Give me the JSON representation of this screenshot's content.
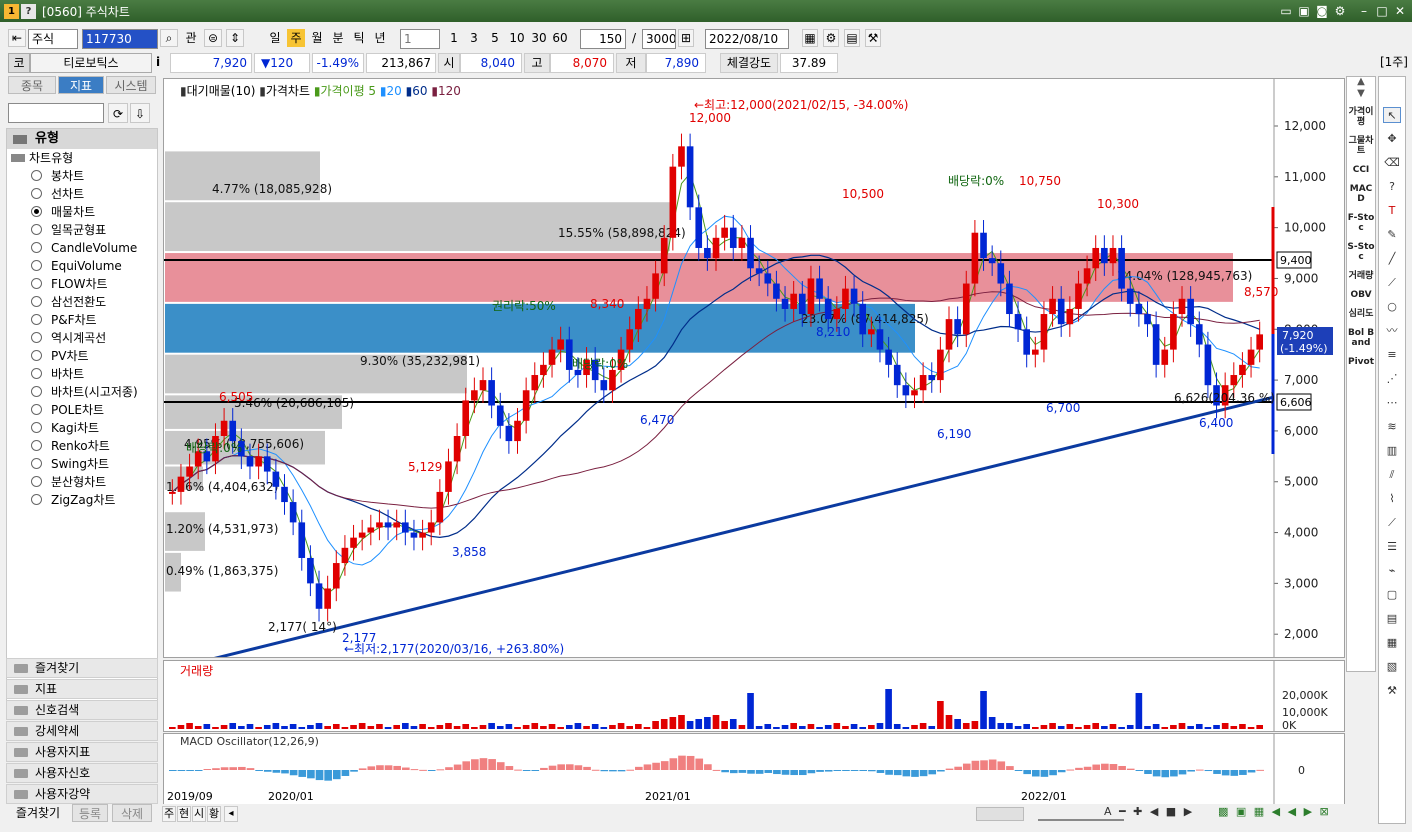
{
  "window": {
    "title": "[0560] 주식차트",
    "icon_a": "1",
    "icon_b": "?"
  },
  "toolbar": {
    "market": "주식",
    "code": "117730",
    "btn_gwan": "관",
    "periods": [
      "일",
      "주",
      "월",
      "분",
      "틱",
      "년"
    ],
    "active_period": "주",
    "sub_select": "1",
    "intervals": [
      "1",
      "3",
      "5",
      "10",
      "30",
      "60"
    ],
    "count": "150",
    "slash": "/",
    "total": "3000",
    "date": "2022/08/10"
  },
  "quote": {
    "ko": "코",
    "name": "티로보틱스",
    "info": "i",
    "price": "7,920",
    "change": "▼120",
    "rate": "-1.49%",
    "volume": "213,867",
    "open_label": "시",
    "open": "8,040",
    "high_label": "고",
    "high": "8,070",
    "low_label": "저",
    "low": "7,890",
    "strength_label": "체결강도",
    "strength": "37.89",
    "unit": "[1주]"
  },
  "left": {
    "tabs": [
      "종목",
      "지표",
      "시스템"
    ],
    "active_tab": "지표",
    "section": "유형",
    "group": "차트유형",
    "items": [
      "봉차트",
      "선차트",
      "매물차트",
      "일목균형표",
      "CandleVolume",
      "EquiVolume",
      "FLOW차트",
      "삼선전환도",
      "P&F차트",
      "역시계곡선",
      "PV차트",
      "바차트",
      "바차트(시고저종)",
      "POLE차트",
      "Kagi차트",
      "Renko차트",
      "Swing차트",
      "분산형차트",
      "ZigZag차트"
    ],
    "selected": "매물차트",
    "categories": [
      "즐겨찾기",
      "지표",
      "신호검색",
      "강세약세",
      "사용자지표",
      "사용자신호",
      "사용자강약"
    ],
    "bottom_tabs": [
      "즐겨찾기",
      "등록",
      "삭제"
    ]
  },
  "chart": {
    "legend": {
      "a": "대기매물(10)",
      "b": "가격차트",
      "c": "가격이평 5",
      "d": "20",
      "e": "60",
      "f": "120"
    },
    "price_labels": [
      "12,000",
      "11,000",
      "10,000",
      "9,000",
      "8,000",
      "7,000",
      "6,000",
      "5,000",
      "4,000",
      "3,000",
      "2,000"
    ],
    "right_tag_9400": "9,400",
    "right_tag_price": "7,920",
    "right_tag_rate": "(-1.49%)",
    "right_tag_6606": "6,606",
    "volume_profile": [
      {
        "label": "4.77% (18,085,928)"
      },
      {
        "label": "15.55% (58,898,824)"
      },
      {
        "label": "23.07% (87,414,825)"
      },
      {
        "label": "34.04% (128,945,763)"
      },
      {
        "label": "9.30% (35,232,981)"
      },
      {
        "label": "5.46% (20,686,105)"
      },
      {
        "label": "4.95% (18,755,606)"
      },
      {
        "label": "1.16% (4,404,632)"
      },
      {
        "label": "1.20% (4,531,973)"
      },
      {
        "label": "0.49% (1,863,375)"
      }
    ],
    "annotations": {
      "max": "←최고:12,000(2021/02/15, -34.00%)",
      "min": "←최저:2,177(2020/03/16, +263.80%)",
      "div1": "배당락:0%",
      "div2": "배당락:0%",
      "div3": "배당락:0%",
      "rights": "권리락:50%",
      "p12000": "12,000",
      "p10500": "10,500",
      "p10750": "10,750",
      "p10300": "10,300",
      "p8340": "8,340",
      "p8570": "8,570",
      "p8210": "8,210",
      "p6505": "6,505",
      "p5129": "5,129",
      "p3858": "3,858",
      "p2177": "2,177",
      "p6470": "6,470",
      "p6190": "6,190",
      "p6700": "6,700",
      "p6400": "6,400",
      "angle": "2,177( 14°)",
      "trend": "6,626(204.36 %)"
    },
    "volume_title": "거래량",
    "volume_labels": [
      "20,000K",
      "10,000K",
      "0K"
    ],
    "macd_title": "MACD Oscillator(12,26,9)",
    "macd_zero": "0",
    "x_labels": [
      "2019/09",
      "2020/01",
      "2021/01",
      "2022/01"
    ]
  },
  "right_tools": [
    "가격이평",
    "그물차트",
    "CCI",
    "MACD",
    "F-Stoc",
    "S-Stoc",
    "거래량",
    "OBV",
    "심리도",
    "Bol Band",
    "Pivot"
  ],
  "bottom": {
    "tabs": [
      "주",
      "현",
      "시",
      "황"
    ]
  },
  "colors": {
    "up": "#e00000",
    "down": "#0026d4",
    "title": "#3a6b35"
  }
}
